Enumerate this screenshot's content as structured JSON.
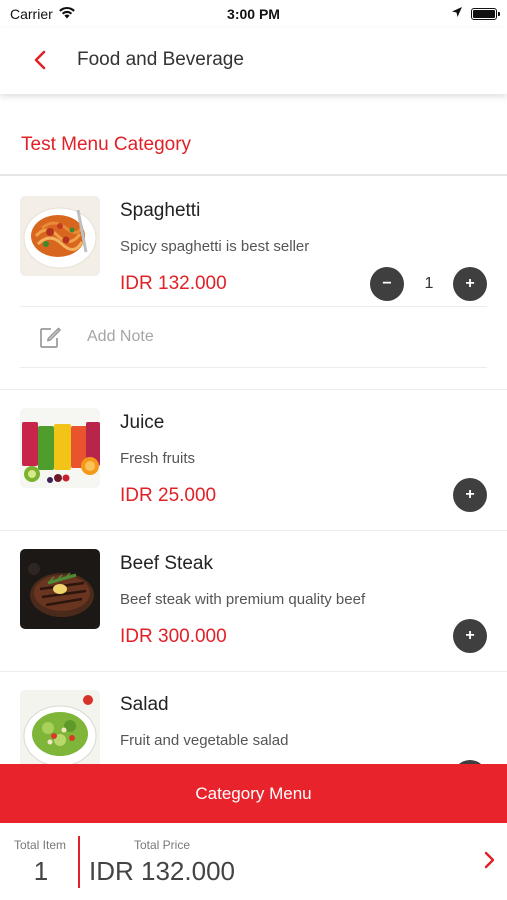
{
  "status_bar": {
    "carrier": "Carrier",
    "time": "3:00 PM"
  },
  "nav": {
    "title": "Food and Beverage"
  },
  "category": {
    "title": "Test Menu Category"
  },
  "items": [
    {
      "name": "Spaghetti",
      "description": "Spicy spaghetti is best seller",
      "price": "IDR 132.000",
      "quantity": "1",
      "note_placeholder": "Add Note"
    },
    {
      "name": "Juice",
      "description": "Fresh fruits",
      "price": "IDR 25.000"
    },
    {
      "name": "Beef Steak",
      "description": "Beef steak with premium quality beef",
      "price": "IDR 300.000"
    },
    {
      "name": "Salad",
      "description": "Fruit and vegetable salad"
    }
  ],
  "buttons": {
    "minus": "−",
    "plus": "+",
    "category_menu": "Category Menu"
  },
  "summary": {
    "total_item_label": "Total Item",
    "total_item_value": "1",
    "total_price_label": "Total Price",
    "total_price_value": "IDR 132.000"
  },
  "colors": {
    "accent": "#e9232b",
    "price": "#e02127",
    "round_button": "#3f3f3f"
  },
  "icons": {
    "back": "chevron-left-icon",
    "note": "edit-note-icon",
    "checkout": "chevron-right-icon",
    "wifi": "wifi-icon",
    "location": "location-arrow-icon",
    "battery": "battery-icon"
  }
}
